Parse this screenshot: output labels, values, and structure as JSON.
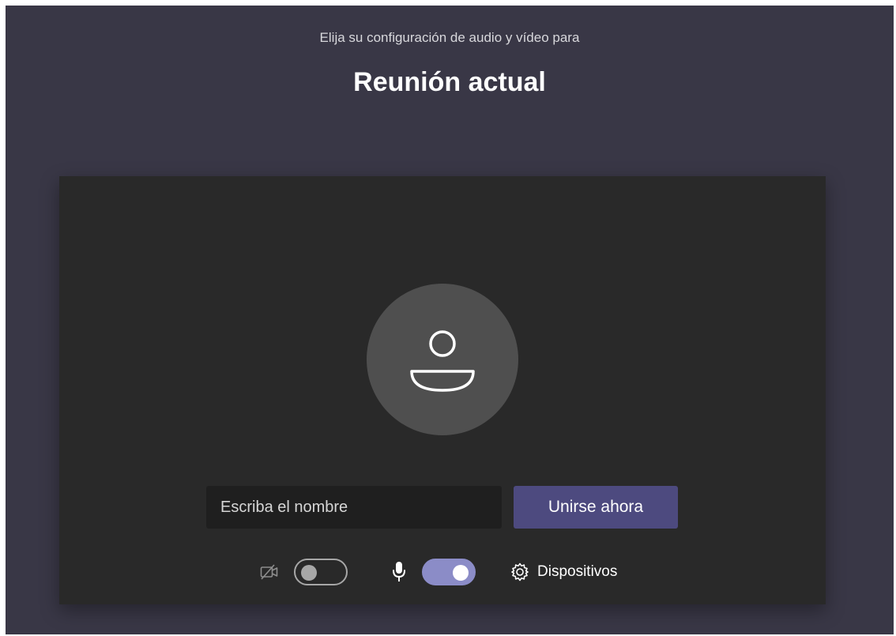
{
  "header": {
    "subtitle": "Elija su configuración de audio y vídeo para",
    "title": "Reunión actual"
  },
  "preview": {
    "avatar_icon": "person-icon",
    "name_input": {
      "placeholder": "Escriba el nombre",
      "value": ""
    },
    "join_button_label": "Unirse ahora"
  },
  "controls": {
    "camera": {
      "icon": "camera-off-icon",
      "enabled": false
    },
    "microphone": {
      "icon": "microphone-icon",
      "enabled": true
    },
    "devices": {
      "icon": "gear-icon",
      "label": "Dispositivos"
    }
  },
  "colors": {
    "app_background": "#393746",
    "preview_background": "#292929",
    "avatar_background": "#4f4f4f",
    "input_background": "#1f1f1f",
    "join_button": "#4d4a7f",
    "toggle_on": "#8b8cc7",
    "toggle_off": "#a7a7a7"
  }
}
